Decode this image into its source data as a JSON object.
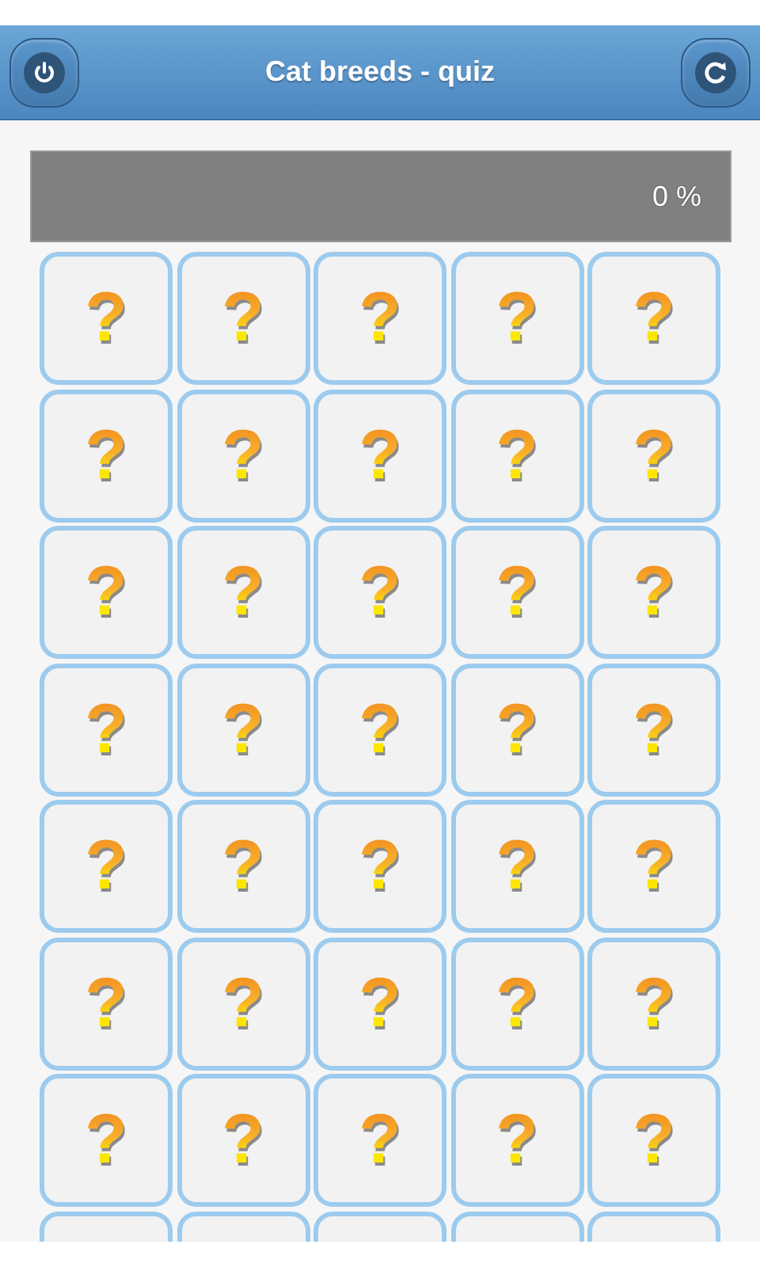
{
  "header": {
    "title": "Cat breeds - quiz"
  },
  "progress": {
    "level": 0,
    "reading": "0 %"
  },
  "tiles": [
    {
      "kind": "question",
      "label": "?"
    },
    {
      "kind": "question",
      "label": "?"
    },
    {
      "kind": "question",
      "label": "?"
    },
    {
      "kind": "question",
      "label": "?"
    },
    {
      "kind": "question",
      "label": "?"
    },
    {
      "kind": "question",
      "label": "?"
    },
    {
      "kind": "question",
      "label": "?"
    },
    {
      "kind": "question",
      "label": "?"
    },
    {
      "kind": "question",
      "label": "?"
    },
    {
      "kind": "question",
      "label": "?"
    },
    {
      "kind": "question",
      "label": "?"
    },
    {
      "kind": "question",
      "label": "?"
    },
    {
      "kind": "question",
      "label": "?"
    },
    {
      "kind": "question",
      "label": "?"
    },
    {
      "kind": "question",
      "label": "?"
    },
    {
      "kind": "question",
      "label": "?"
    },
    {
      "kind": "question",
      "label": "?"
    },
    {
      "kind": "question",
      "label": "?"
    },
    {
      "kind": "question",
      "label": "?"
    },
    {
      "kind": "question",
      "label": "?"
    },
    {
      "kind": "question",
      "label": "?"
    },
    {
      "kind": "question",
      "label": "?"
    },
    {
      "kind": "question",
      "label": "?"
    },
    {
      "kind": "question",
      "label": "?"
    },
    {
      "kind": "question",
      "label": "?"
    },
    {
      "kind": "question",
      "label": "?"
    },
    {
      "kind": "question",
      "label": "?"
    },
    {
      "kind": "question",
      "label": "?"
    },
    {
      "kind": "question",
      "label": "?"
    },
    {
      "kind": "question",
      "label": "?"
    },
    {
      "kind": "question",
      "label": "?"
    },
    {
      "kind": "question",
      "label": "?"
    },
    {
      "kind": "question",
      "label": "?"
    },
    {
      "kind": "question",
      "label": "?"
    },
    {
      "kind": "question",
      "label": "?"
    },
    {
      "kind": "cut"
    },
    {
      "kind": "cut"
    },
    {
      "kind": "cut"
    },
    {
      "kind": "cut"
    },
    {
      "kind": "cut"
    }
  ]
}
